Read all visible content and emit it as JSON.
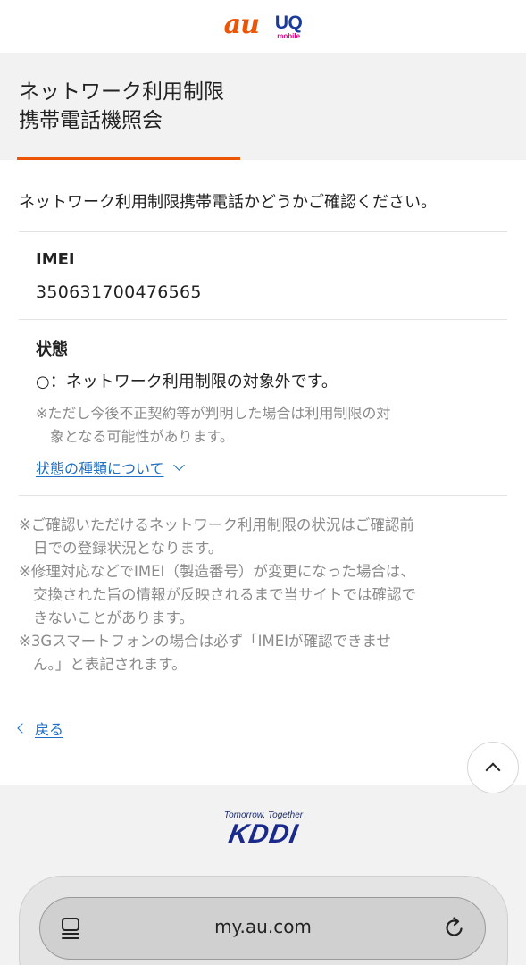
{
  "header": {
    "logo_au": "au",
    "logo_uq": "UQ",
    "logo_uq_sub": "mobile"
  },
  "page_title": {
    "line1": "ネットワーク利用制限",
    "line2": "携帯電話機照会"
  },
  "intro": "ネットワーク利用制限携帯電話かどうかご確認ください。",
  "imei": {
    "label": "IMEI",
    "value": "350631700476565"
  },
  "status": {
    "label": "状態",
    "result": "○：ネットワーク利用制限の対象外です。",
    "note_line1": "※ただし今後不正契約等が判明した場合は利用制限の対",
    "note_line2": "象となる可能性があります。",
    "types_link": "状態の種類について"
  },
  "notes": [
    "※ご確認いただけるネットワーク利用制限の状況はご確認前",
    "日での登録状況となります。",
    "※修理対応などでIMEI（製造番号）が変更になった場合は、",
    "交換された旨の情報が反映されるまで当サイトでは確認で",
    "きないことがあります。",
    "※3Gスマートフォンの場合は必ず「IMEIが確認できませ",
    "ん。」と表記されます。"
  ],
  "back_link": "戻る",
  "footer": {
    "tagline": "Tomorrow, Together",
    "brand": "KDDI"
  },
  "browser": {
    "url": "my.au.com"
  },
  "icons": {
    "to_top": "chevron-up-icon",
    "tabs": "tabs-icon",
    "reload": "reload-icon"
  },
  "colors": {
    "accent": "#eb5505",
    "link": "#1f6fc4",
    "muted_text": "#8a8a8a",
    "band_bg": "#f2f2f2"
  }
}
